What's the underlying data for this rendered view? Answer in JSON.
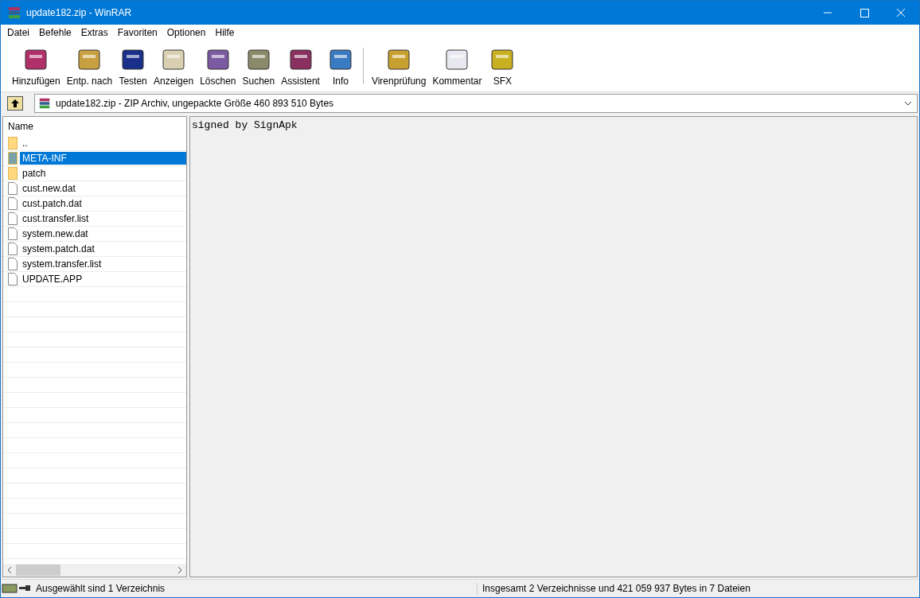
{
  "window": {
    "title": "update182.zip - WinRAR"
  },
  "menu": [
    "Datei",
    "Befehle",
    "Extras",
    "Favoriten",
    "Optionen",
    "Hilfe"
  ],
  "toolbar": [
    {
      "label": "Hinzufügen"
    },
    {
      "label": "Entp. nach"
    },
    {
      "label": "Testen"
    },
    {
      "label": "Anzeigen"
    },
    {
      "label": "Löschen"
    },
    {
      "label": "Suchen"
    },
    {
      "label": "Assistent"
    },
    {
      "label": "Info"
    },
    {
      "label": "Virenprüfung"
    },
    {
      "label": "Kommentar"
    },
    {
      "label": "SFX"
    }
  ],
  "address": {
    "value": "update182.zip - ZIP Archiv, ungepackte Größe 460 893 510 Bytes"
  },
  "file_list": {
    "column": "Name",
    "rows": [
      {
        "name": "..",
        "kind": "folder",
        "selected": false
      },
      {
        "name": "META-INF",
        "kind": "folder",
        "selected": true
      },
      {
        "name": "patch",
        "kind": "folder",
        "selected": false
      },
      {
        "name": "cust.new.dat",
        "kind": "file",
        "selected": false
      },
      {
        "name": "cust.patch.dat",
        "kind": "file",
        "selected": false
      },
      {
        "name": "cust.transfer.list",
        "kind": "file",
        "selected": false
      },
      {
        "name": "system.new.dat",
        "kind": "file",
        "selected": false
      },
      {
        "name": "system.patch.dat",
        "kind": "file",
        "selected": false
      },
      {
        "name": "system.transfer.list",
        "kind": "file",
        "selected": false
      },
      {
        "name": "UPDATE.APP",
        "kind": "file",
        "selected": false
      }
    ]
  },
  "comment": {
    "text": "signed by SignApk"
  },
  "status_bar": {
    "left": "Ausgewählt sind 1 Verzeichnis",
    "right": "Insgesamt 2 Verzeichnisse und 421 059 937 Bytes in 7 Dateien"
  }
}
